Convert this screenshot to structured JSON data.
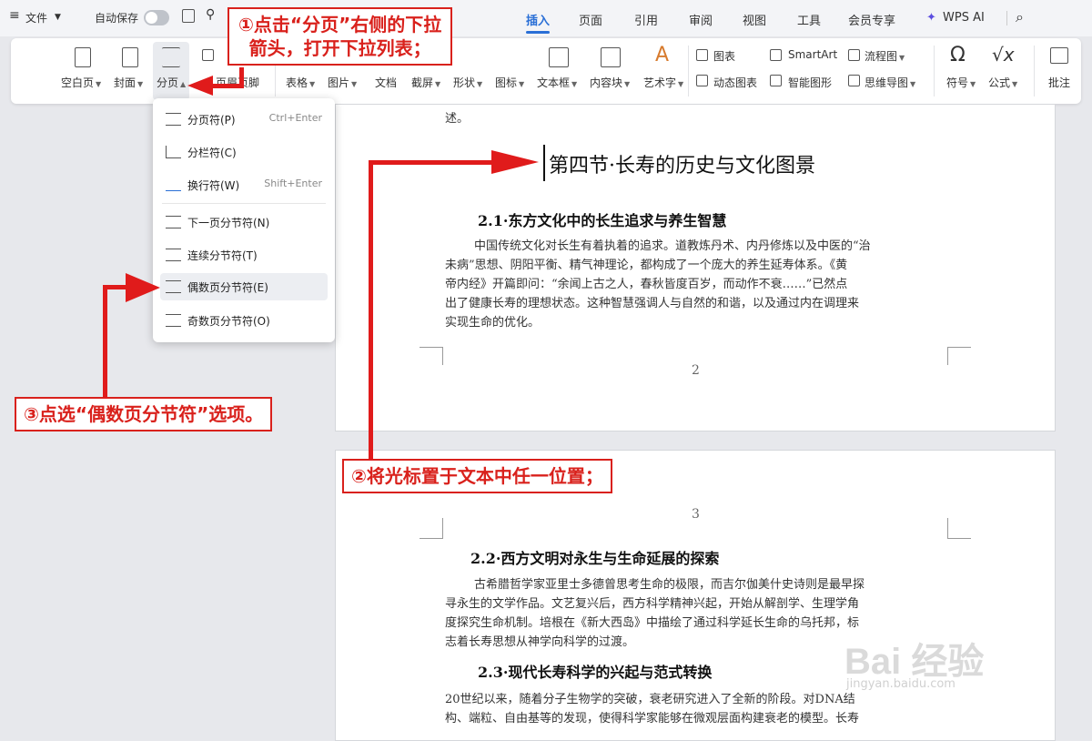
{
  "topbar": {
    "file_label": "文件",
    "autosave_label": "自动保存",
    "tabs": [
      "插入",
      "页面",
      "引用",
      "审阅",
      "视图",
      "工具",
      "会员专享"
    ],
    "active_tab": "插入",
    "wps_ai_label": "WPS AI"
  },
  "ribbon": {
    "blank_page": "空白页",
    "cover": "封面",
    "page_break": "分页",
    "header_footer": "页眉页脚",
    "table": "表格",
    "picture": "图片",
    "doc": "文档",
    "screenshot": "截屏",
    "shape": "形状",
    "icon": "图标",
    "textbox": "文本框",
    "content_block": "内容块",
    "art_text": "艺术字",
    "chart": "图表",
    "dynamic_chart": "动态图表",
    "smartart": "SmartArt",
    "smart_shape": "智能图形",
    "flowchart": "流程图",
    "mindmap": "思维导图",
    "symbol": "符号",
    "formula": "公式",
    "comment": "批注"
  },
  "dropdown": {
    "items": [
      {
        "label": "分页符(P)",
        "shortcut": "Ctrl+Enter"
      },
      {
        "label": "分栏符(C)",
        "shortcut": ""
      },
      {
        "label": "换行符(W)",
        "shortcut": "Shift+Enter"
      },
      {
        "label": "下一页分节符(N)",
        "shortcut": ""
      },
      {
        "label": "连续分节符(T)",
        "shortcut": ""
      },
      {
        "label": "偶数页分节符(E)",
        "shortcut": ""
      },
      {
        "label": "奇数页分节符(O)",
        "shortcut": ""
      }
    ],
    "highlighted": "偶数页分节符(E)"
  },
  "document": {
    "page2": {
      "top_fragment": "述。",
      "section_title": "第四节·长寿的历史与文化图景",
      "heading": "2.1·东方文化中的长生追求与养生智慧",
      "paragraph_lines": [
        "中国传统文化对长生有着执着的追求。道教炼丹术、内丹修炼以及中医的“治",
        "未病”思想、阴阳平衡、精气神理论，都构成了一个庞大的养生延寿体系。《黄",
        "帝内经》开篇即问：“余闻上古之人，春秋皆度百岁，而动作不衰……”已然点",
        "出了健康长寿的理想状态。这种智慧强调人与自然的和谐，以及通过内在调理来",
        "实现生命的优化。"
      ],
      "page_number": "2"
    },
    "page3": {
      "page_number": "3",
      "heading1": "2.2·西方文明对永生与生命延展的探索",
      "paragraph1_lines": [
        "古希腊哲学家亚里士多德曾思考生命的极限，而吉尔伽美什史诗则是最早探",
        "寻永生的文学作品。文艺复兴后，西方科学精神兴起，开始从解剖学、生理学角",
        "度探究生命机制。培根在《新大西岛》中描绘了通过科学延长生命的乌托邦，标",
        "志着长寿思想从神学向科学的过渡。"
      ],
      "heading2": "2.3·现代长寿科学的兴起与范式转换",
      "paragraph2_lines": [
        "20世纪以来，随着分子生物学的突破，衰老研究进入了全新的阶段。对DNA结",
        "构、端粒、自由基等的发现，使得科学家能够在微观层面构建衰老的模型。长寿"
      ]
    }
  },
  "annotations": {
    "step1": [
      "①点击“分页”右侧的下拉",
      "箭头，打开下拉列表；"
    ],
    "step2": "②将光标置于文本中任一位置；",
    "step3": "③点选“偶数页分节符”选项。"
  },
  "watermark": {
    "text": "Bai 经验",
    "subtext": "jingyan.baidu.com"
  },
  "colors": {
    "accent": "#2a6fd6",
    "annotation_red": "#d9211c"
  }
}
